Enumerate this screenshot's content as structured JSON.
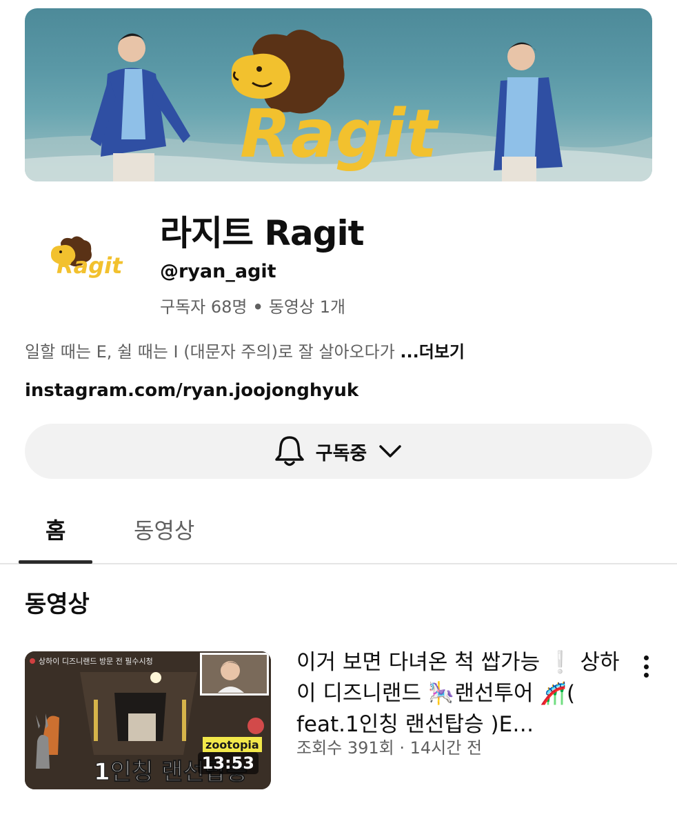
{
  "banner": {
    "logo_text": "Ragit"
  },
  "avatar": {
    "logo_text": "Ragit"
  },
  "channel": {
    "name": "라지트 Ragit",
    "handle": "@ryan_agit",
    "subscribers": "구독자 68명",
    "separator": "•",
    "video_count": "동영상 1개",
    "description": "일할 때는 E, 쉴 때는 I (대문자 주의)로 잘 살아오다가 ",
    "more_label": "...더보기",
    "link": "instagram.com/ryan.joojonghyuk"
  },
  "subscribe": {
    "label": "구독중"
  },
  "tabs": [
    {
      "label": "홈"
    },
    {
      "label": "동영상"
    }
  ],
  "section": {
    "title": "동영상"
  },
  "video": {
    "thumb_caption": "상하이 디즈니랜드 방문 전 필수시청",
    "thumb_tag": "zootopia",
    "thumb_overlay": "1인칭 랜선탑승",
    "duration": "13:53",
    "title": "이거 보면 다녀온 척 쌉가능 ❕ 상하이 디즈니랜드 🎠랜선투어 🎢( feat.1인칭 랜선탑승 )E…",
    "meta": "조회수 391회 · 14시간 전"
  },
  "colors": {
    "accent_yellow": "#f2c12e",
    "lion_brown": "#5a3216",
    "subscribe_bg": "#f2f2f2"
  }
}
